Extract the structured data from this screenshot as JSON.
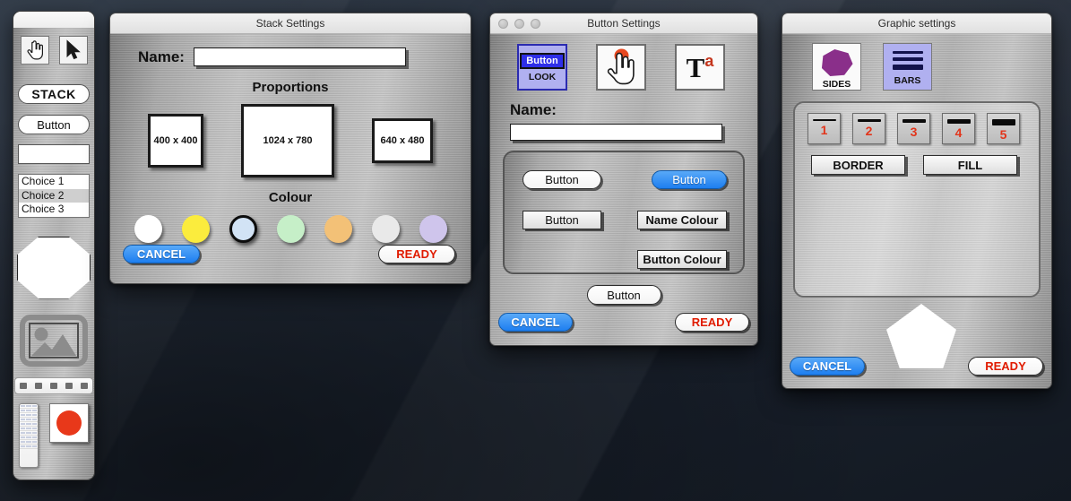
{
  "desktop": {
    "background_color": "#1b2330"
  },
  "sidebar": {
    "name": "tool-palette",
    "tools": [
      {
        "id": "hand-tool",
        "icon": "pointing-hand-icon"
      },
      {
        "id": "arrow-tool",
        "icon": "arrow-cursor-icon"
      }
    ],
    "stack_label": "STACK",
    "button_label": "Button",
    "text_field_value": "",
    "list_items": [
      {
        "label": "Choice 1",
        "selected": false
      },
      {
        "label": "Choice 2",
        "selected": true
      },
      {
        "label": "Choice 3",
        "selected": false
      }
    ],
    "shape_icon": "octagon-shape",
    "image_icon": "picture-placeholder-icon",
    "toolbar_thumb_icon": "mini-toolbar-thumbnail",
    "panel_thumb_icon": "mini-panel-thumbnail",
    "colour_swatch": {
      "icon": "colour-swatch-icon",
      "color": "#e8381a"
    }
  },
  "stack_window": {
    "title": "Stack Settings",
    "name_label": "Name:",
    "name_value": "",
    "proportions_heading": "Proportions",
    "proportions": [
      {
        "label": "400 x 400"
      },
      {
        "label": "1024 x 780"
      },
      {
        "label": "640 x 480"
      }
    ],
    "colour_heading": "Colour",
    "colours": [
      {
        "name": "white",
        "hex": "#ffffff",
        "selected": false
      },
      {
        "name": "yellow",
        "hex": "#fbec3d",
        "selected": false
      },
      {
        "name": "light-blue",
        "hex": "#d2e3f5",
        "selected": true
      },
      {
        "name": "light-green",
        "hex": "#c6efc8",
        "selected": false
      },
      {
        "name": "orange",
        "hex": "#f3c177",
        "selected": false
      },
      {
        "name": "light-grey",
        "hex": "#e9e9e9",
        "selected": false
      },
      {
        "name": "lavender",
        "hex": "#cfc5ec",
        "selected": false
      }
    ],
    "cancel_label": "CANCEL",
    "ready_label": "READY"
  },
  "button_window": {
    "title": "Button Settings",
    "tabs": [
      {
        "id": "look",
        "chip_label": "Button",
        "caption": "LOOK",
        "icon": "button-look-icon",
        "active": true
      },
      {
        "id": "action",
        "chip_label": "",
        "caption": "",
        "icon": "pointing-hand-click-icon",
        "active": false
      },
      {
        "id": "text",
        "chip_label": "",
        "caption": "",
        "icon": "text-style-Ta-icon",
        "active": false
      }
    ],
    "name_label": "Name:",
    "name_value": "",
    "style_buttons": [
      {
        "id": "style-rounded-white",
        "label": "Button",
        "style": "rounded-white"
      },
      {
        "id": "style-rounded-blue",
        "label": "Button",
        "style": "rounded-blue"
      },
      {
        "id": "style-square-grey",
        "label": "Button",
        "style": "square-grey"
      },
      {
        "id": "name-colour",
        "label": "Name Colour",
        "style": "square-grey"
      },
      {
        "id": "button-colour",
        "label": "Button Colour",
        "style": "square-grey"
      }
    ],
    "preview_label": "Button",
    "cancel_label": "CANCEL",
    "ready_label": "READY"
  },
  "graphic_window": {
    "title": "Graphic settings",
    "tabs": [
      {
        "id": "sides",
        "caption": "SIDES",
        "icon": "polygon-sides-icon",
        "active": false
      },
      {
        "id": "bars",
        "caption": "BARS",
        "icon": "line-bars-icon",
        "active": true
      }
    ],
    "thickness_options": [
      {
        "label": "1",
        "thickness": 2
      },
      {
        "label": "2",
        "thickness": 3
      },
      {
        "label": "3",
        "thickness": 4
      },
      {
        "label": "4",
        "thickness": 5
      },
      {
        "label": "5",
        "thickness": 7
      }
    ],
    "border_label": "BORDER",
    "fill_label": "FILL",
    "preview_shape": "pentagon",
    "cancel_label": "CANCEL",
    "ready_label": "READY"
  }
}
